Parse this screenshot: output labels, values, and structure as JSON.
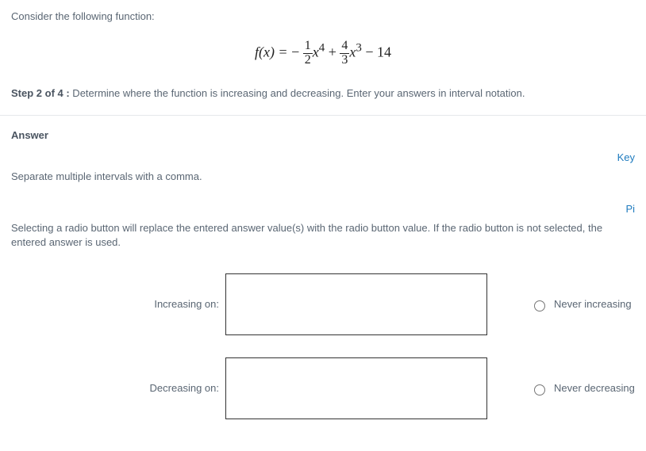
{
  "intro": "Consider the following function:",
  "equation": {
    "lhs": "f(x) = ",
    "term1_sign": "−",
    "term1_num": "1",
    "term1_den": "2",
    "term1_tail": "x",
    "term1_exp": "4",
    "plus1": " + ",
    "term2_num": "4",
    "term2_den": "3",
    "term2_tail": "x",
    "term2_exp": "3",
    "tail": " − 14"
  },
  "step": {
    "label": "Step 2 of 4 :",
    "text": " Determine where the function is increasing and decreasing. Enter your answers in interval notation."
  },
  "answer_head": "Answer",
  "key_link": "Key",
  "separator_hint": "Separate multiple intervals with a comma.",
  "pi_link": "Pi",
  "radio_hint": "Selecting a radio button will replace the entered answer value(s) with the radio button value. If the radio button is not selected, the entered answer is used.",
  "rows": {
    "increasing": {
      "label": "Increasing on:",
      "value": "",
      "never_label": "Never increasing"
    },
    "decreasing": {
      "label": "Decreasing on:",
      "value": "",
      "never_label": "Never decreasing"
    }
  }
}
